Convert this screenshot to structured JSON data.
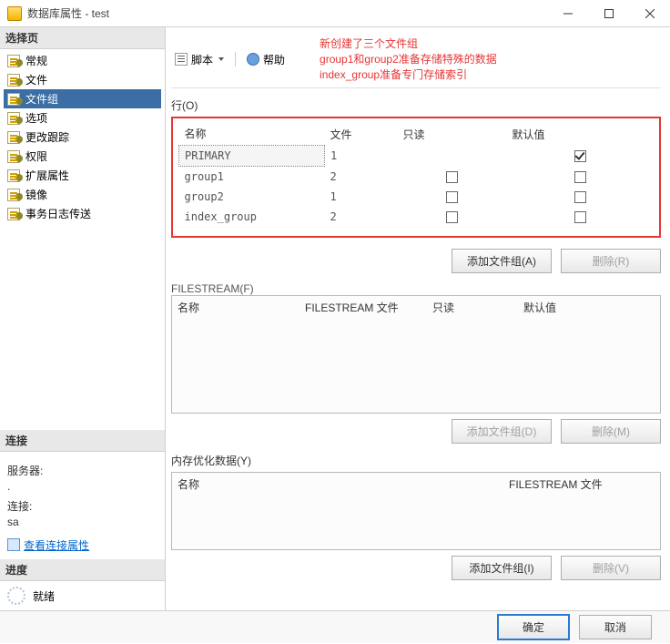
{
  "title": "数据库属性 - test",
  "sidebar": {
    "select_header": "选择页",
    "items": [
      {
        "label": "常规"
      },
      {
        "label": "文件"
      },
      {
        "label": "文件组"
      },
      {
        "label": "选项"
      },
      {
        "label": "更改跟踪"
      },
      {
        "label": "权限"
      },
      {
        "label": "扩展属性"
      },
      {
        "label": "镜像"
      },
      {
        "label": "事务日志传送"
      }
    ],
    "selected_index": 2,
    "conn_header": "连接",
    "server_label": "服务器:",
    "server_value": ".",
    "conn_label": "连接:",
    "conn_value": "sa",
    "view_conn_link": "查看连接属性",
    "progress_header": "进度",
    "progress_status": "就绪"
  },
  "toolbar": {
    "script_label": "脚本",
    "help_label": "帮助"
  },
  "annotation": {
    "line1": "新创建了三个文件组",
    "line2": "group1和group2准备存储特殊的数据",
    "line3": "index_group准备专门存储索引"
  },
  "rows_section": {
    "label": "行(O)",
    "columns": {
      "name": "名称",
      "files": "文件",
      "readonly": "只读",
      "default": "默认值"
    },
    "rows": [
      {
        "name": "PRIMARY",
        "files": "1",
        "readonly": null,
        "default": true
      },
      {
        "name": "group1",
        "files": "2",
        "readonly": false,
        "default": false
      },
      {
        "name": "group2",
        "files": "1",
        "readonly": false,
        "default": false
      },
      {
        "name": "index_group",
        "files": "2",
        "readonly": false,
        "default": false
      }
    ],
    "add_btn": "添加文件组(A)",
    "del_btn": "删除(R)"
  },
  "filestream_section": {
    "label": "FILESTREAM(F)",
    "columns": {
      "name": "名称",
      "fsfiles": "FILESTREAM 文件",
      "readonly": "只读",
      "default": "默认值"
    },
    "add_btn": "添加文件组(D)",
    "del_btn": "删除(M)"
  },
  "mem_section": {
    "label": "内存优化数据(Y)",
    "columns": {
      "name": "名称",
      "fsfiles": "FILESTREAM 文件"
    },
    "add_btn": "添加文件组(I)",
    "del_btn": "删除(V)"
  },
  "footer": {
    "ok": "确定",
    "cancel": "取消"
  }
}
